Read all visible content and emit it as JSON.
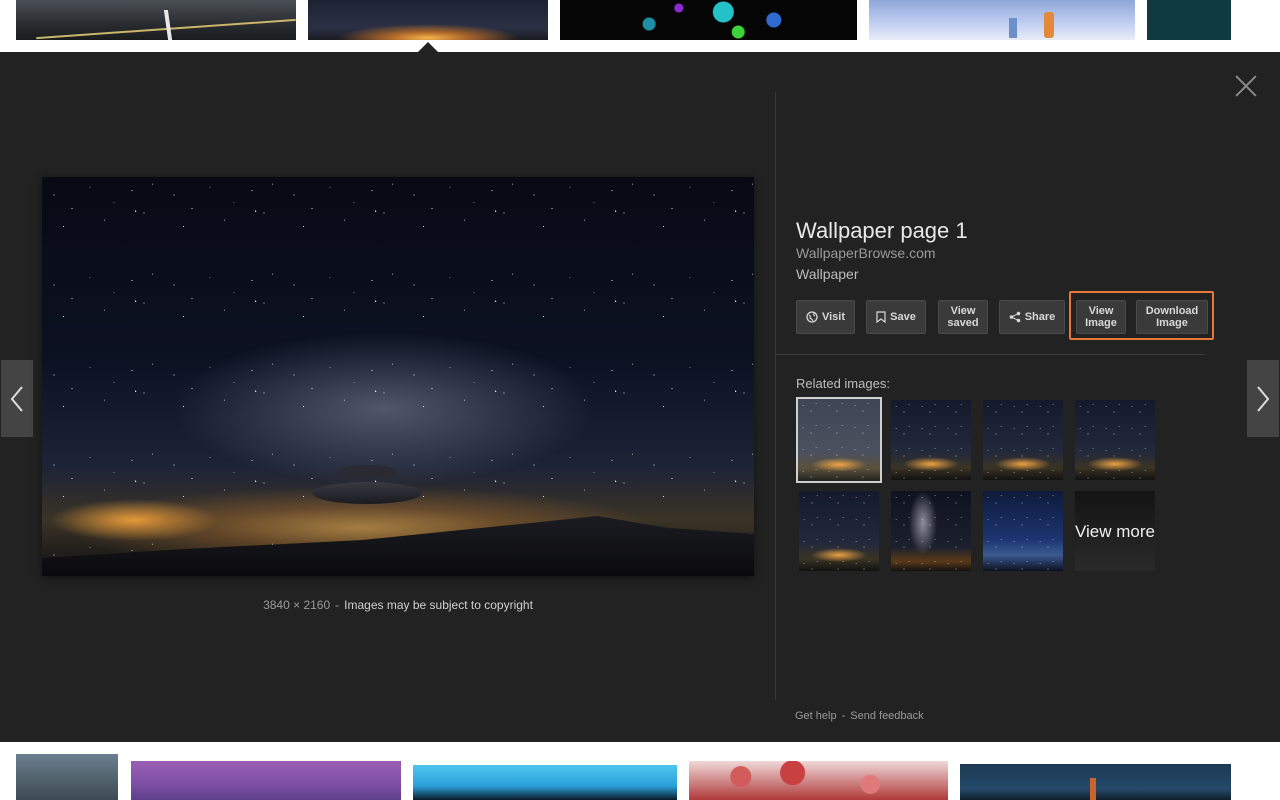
{
  "preview": {
    "title": "Wallpaper page 1",
    "source": "WallpaperBrowse.com",
    "category": "Wallpaper",
    "dimensions": "3840 × 2160",
    "copyright_text": "Images may be subject to copyright"
  },
  "actions": {
    "visit": "Visit",
    "save": "Save",
    "view_saved": "View saved",
    "share": "Share",
    "view_image": "View Image",
    "download_image": "Download Image"
  },
  "related": {
    "label": "Related images:",
    "view_more": "View more"
  },
  "footer": {
    "help": "Get help",
    "feedback": "Send feedback"
  },
  "colors": {
    "panel_bg": "#222222",
    "highlight_outline": "#e8773a"
  },
  "icons": [
    "close-icon",
    "chevron-left-icon",
    "chevron-right-icon",
    "globe-icon",
    "bookmark-icon",
    "share-icon"
  ]
}
